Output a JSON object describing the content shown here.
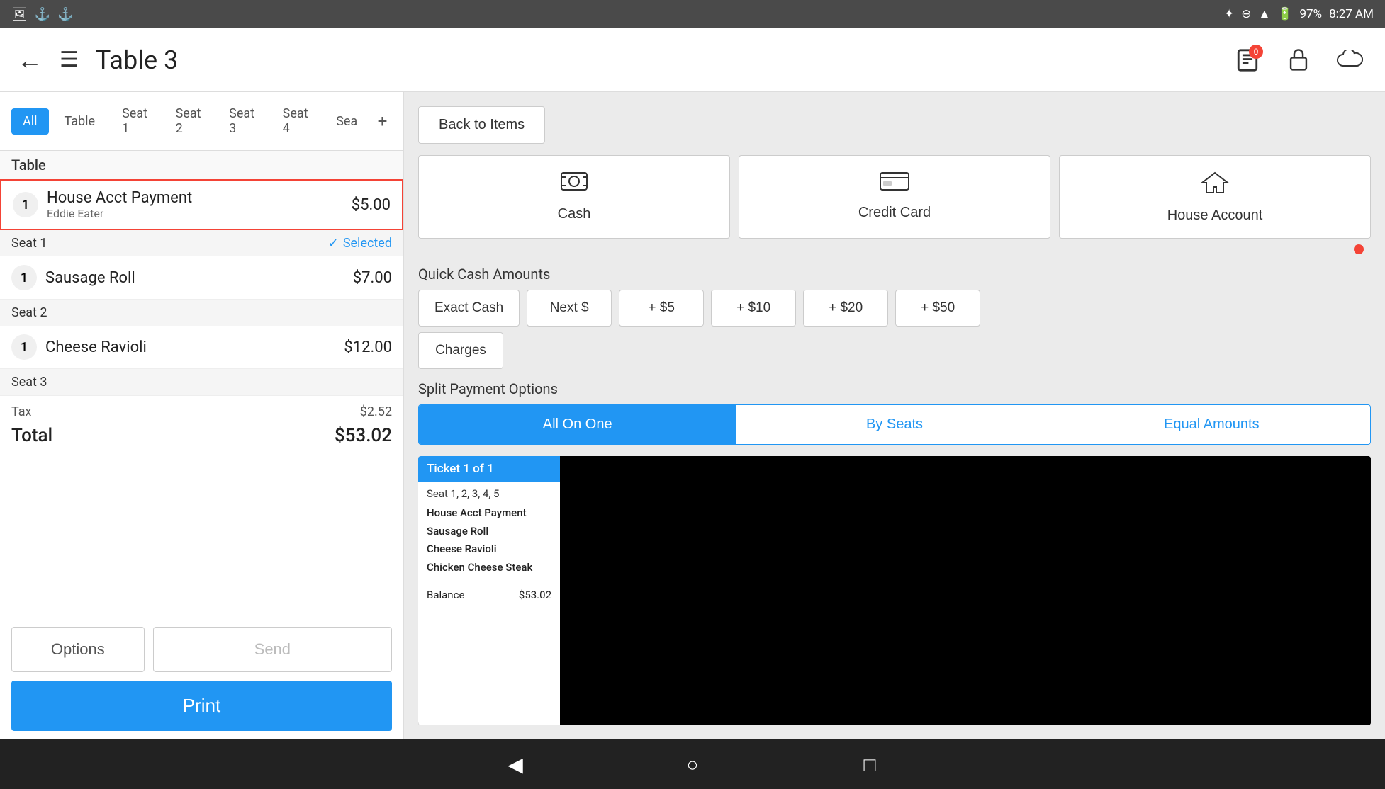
{
  "statusBar": {
    "time": "8:27 AM",
    "battery": "97%",
    "icons": [
      "bluetooth",
      "minus-circle",
      "wifi",
      "battery"
    ]
  },
  "topBar": {
    "title": "Table 3",
    "badgeCount": "0"
  },
  "tabs": {
    "items": [
      "All",
      "Table",
      "Seat 1",
      "Seat 2",
      "Seat 3",
      "Seat 4",
      "Sea"
    ],
    "activeIndex": 0
  },
  "orderList": {
    "sections": [
      {
        "type": "section-header",
        "label": "Table"
      },
      {
        "type": "item",
        "qty": "1",
        "name": "House Acct Payment",
        "sub": "Eddie Eater",
        "price": "$5.00",
        "selected": true
      },
      {
        "type": "seat-header",
        "label": "Seat 1",
        "selected": true
      },
      {
        "type": "item",
        "qty": "1",
        "name": "Sausage Roll",
        "sub": "",
        "price": "$7.00",
        "selected": false
      },
      {
        "type": "seat-header",
        "label": "Seat 2",
        "selected": false
      },
      {
        "type": "item",
        "qty": "1",
        "name": "Cheese Ravioli",
        "sub": "",
        "price": "$12.00",
        "selected": false
      },
      {
        "type": "seat-header",
        "label": "Seat 3",
        "selected": false
      }
    ],
    "tax": "$2.52",
    "total": "$53.02"
  },
  "bottomButtons": {
    "options": "Options",
    "send": "Send",
    "print": "Print"
  },
  "rightPanel": {
    "backButton": "Back to Items",
    "paymentMethods": [
      {
        "label": "Cash",
        "icon": "💵"
      },
      {
        "label": "Credit Card",
        "icon": "💳"
      },
      {
        "label": "House Account",
        "icon": "🏠"
      }
    ],
    "quickCash": {
      "label": "Quick Cash Amounts",
      "buttons": [
        "Exact Cash",
        "Next $",
        "+ $5",
        "+ $10",
        "+ $20",
        "+ $50"
      ],
      "chargesButton": "Charges"
    },
    "splitPayment": {
      "label": "Split Payment Options",
      "tabs": [
        "All On One",
        "By Seats",
        "Equal Amounts"
      ],
      "activeTab": 0
    },
    "ticket": {
      "header": "Ticket 1 of 1",
      "seats": "Seat 1, 2, 3, 4, 5",
      "items": [
        "House Acct Payment",
        "Sausage Roll",
        "Cheese Ravioli",
        "Chicken Cheese Steak"
      ],
      "balanceLabel": "Balance",
      "balanceValue": "$53.02"
    }
  },
  "bottomNav": {
    "back": "◁",
    "home": "○",
    "square": "□"
  }
}
